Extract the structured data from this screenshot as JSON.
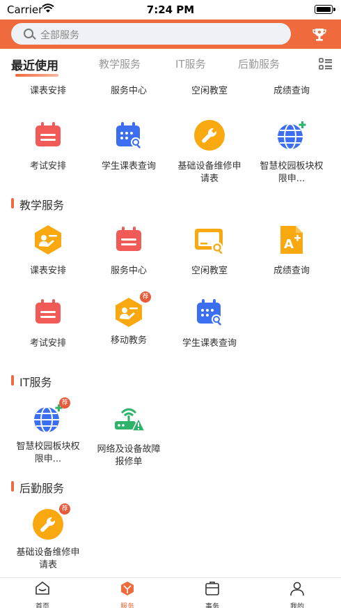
{
  "status": {
    "carrier": "Carrier",
    "time": "7:24 PM"
  },
  "search": {
    "placeholder": "全部服务"
  },
  "tabs": [
    "最近使用",
    "教学服务",
    "IT服务",
    "后勤服务"
  ],
  "recent": {
    "cut_labels": [
      "课表安排",
      "服务中心",
      "空闲教室",
      "成绩查询"
    ],
    "items": [
      "考试安排",
      "学生课表查询",
      "基础设备维修申请表",
      "智慧校园板块权限申..."
    ]
  },
  "sections": {
    "teaching": {
      "title": "教学服务",
      "items": [
        "课表安排",
        "服务中心",
        "空闲教室",
        "成绩查询",
        "考试安排",
        "移动教务",
        "学生课表查询"
      ]
    },
    "it": {
      "title": "IT服务",
      "items": [
        "智慧校园板块权限申...",
        "网络及设备故障报修单"
      ]
    },
    "logistics": {
      "title": "后勤服务",
      "items": [
        "基础设备维修申请表"
      ]
    }
  },
  "badge_text": "荐",
  "bottom_nav": [
    "首页",
    "服务",
    "事务",
    "我的"
  ],
  "colors": {
    "accent": "#ef6a3c",
    "red_icon": "#f05a57",
    "blue_icon": "#3c6ef0",
    "yellow_icon": "#f9a90f"
  }
}
